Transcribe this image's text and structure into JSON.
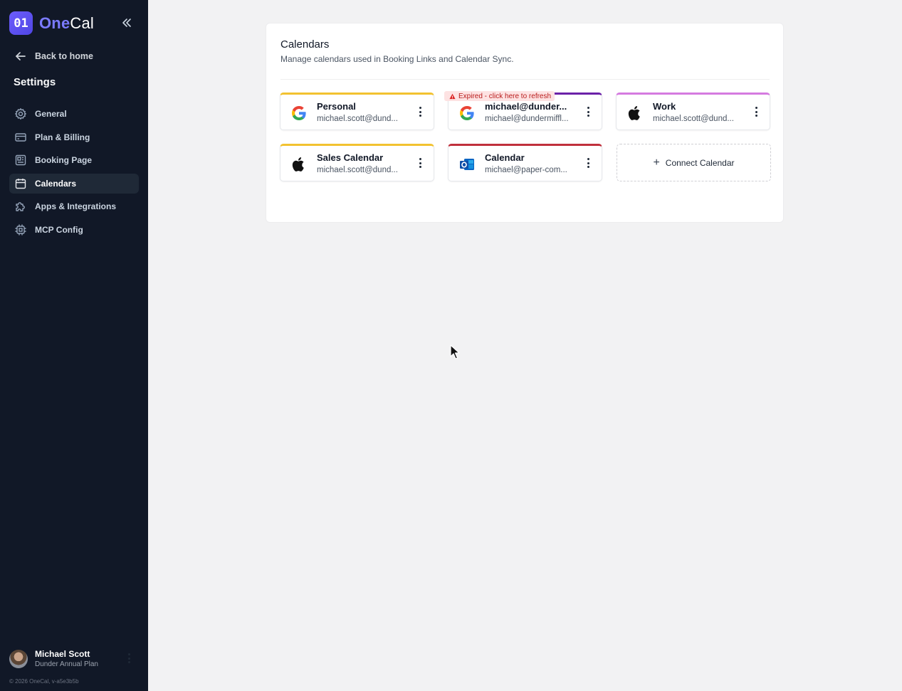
{
  "brand": {
    "mark": "01",
    "name_part1": "One",
    "name_part2": "Cal"
  },
  "sidebar": {
    "back_label": "Back to home",
    "settings_title": "Settings",
    "items": [
      {
        "label": "General",
        "icon": "gear-icon"
      },
      {
        "label": "Plan & Billing",
        "icon": "credit-card-icon"
      },
      {
        "label": "Booking Page",
        "icon": "page-icon"
      },
      {
        "label": "Calendars",
        "icon": "calendar-icon",
        "active": true
      },
      {
        "label": "Apps & Integrations",
        "icon": "puzzle-icon"
      },
      {
        "label": "MCP Config",
        "icon": "chip-icon"
      }
    ],
    "user": {
      "name": "Michael Scott",
      "plan": "Dunder Annual Plan"
    },
    "footer": "© 2026 OneCal, v-a5e3b5b"
  },
  "main": {
    "title": "Calendars",
    "description": "Manage calendars used in Booking Links and Calendar Sync.",
    "calendars": [
      {
        "name": "Personal",
        "email": "michael.scott@dund...",
        "provider": "google",
        "accent": "#f2c230"
      },
      {
        "name": "michael@dunder...",
        "email": "michael@dundermiffl...",
        "provider": "google",
        "accent": "#6b21a8",
        "warning": "Expired - click here to refresh"
      },
      {
        "name": "Work",
        "email": "michael.scott@dund...",
        "provider": "apple",
        "accent": "#d57be0"
      },
      {
        "name": "Sales Calendar",
        "email": "michael.scott@dund...",
        "provider": "apple",
        "accent": "#f2c230"
      },
      {
        "name": "Calendar",
        "email": "michael@paper-com...",
        "provider": "outlook",
        "accent": "#c0303c"
      }
    ],
    "connect_label": "Connect Calendar"
  }
}
